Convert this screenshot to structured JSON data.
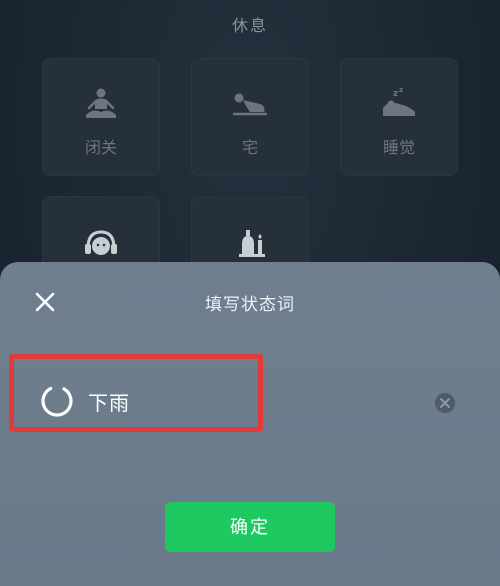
{
  "background": {
    "section_title": "休息",
    "tiles": [
      {
        "label": "闭关",
        "icon": "meditation-icon"
      },
      {
        "label": "宅",
        "icon": "lying-person-icon"
      },
      {
        "label": "睡觉",
        "icon": "sleep-zzz-icon"
      },
      {
        "label": "",
        "icon": "headphones-face-icon"
      },
      {
        "label": "",
        "icon": "bell-candle-icon"
      }
    ]
  },
  "sheet": {
    "title": "填写状态词",
    "close_icon": "close-icon",
    "status_icon": "loading-ring-icon",
    "status_text": "下雨",
    "clear_icon": "clear-circle-icon",
    "confirm_label": "确定"
  },
  "colors": {
    "accent_green": "#1ec962",
    "highlight_red": "#e23a3a",
    "sheet_bg": "#6f7f8e",
    "page_bg": "#1c2632"
  }
}
